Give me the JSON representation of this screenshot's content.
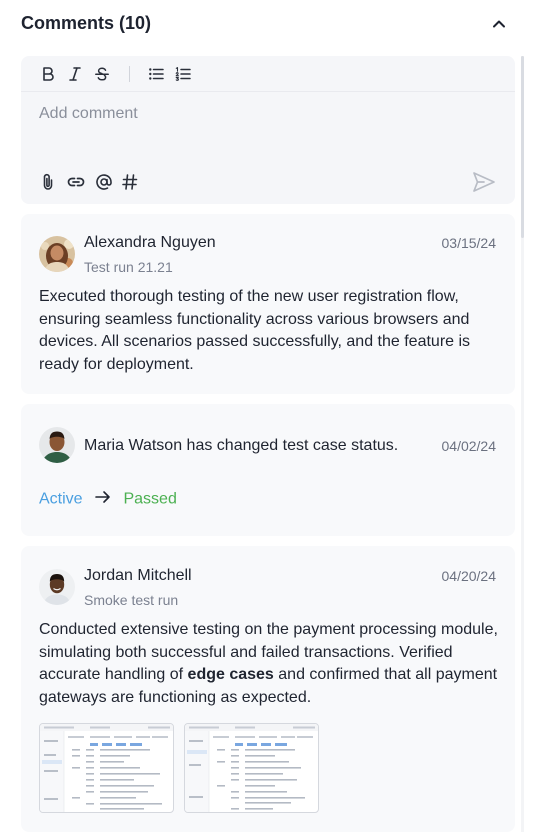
{
  "header": {
    "title": "Comments (10)",
    "collapse_icon": "chevron-up-icon"
  },
  "editor": {
    "toolbar": [
      "bold-icon",
      "italic-icon",
      "strikethrough-icon",
      "bulleted-list-icon",
      "numbered-list-icon"
    ],
    "placeholder": "Add comment",
    "actions": [
      "attachment-icon",
      "link-icon",
      "mention-icon",
      "hashtag-icon"
    ],
    "send_icon": "send-icon"
  },
  "comments": [
    {
      "author": "Alexandra Nguyen",
      "subtitle": "Test run 21.21",
      "date": "03/15/24",
      "text": "Executed thorough testing of the new user registration flow, ensuring seamless functionality across various browsers and devices. All scenarios passed successfully, and the feature is ready for deployment."
    },
    {
      "message": "Maria Watson has changed test case status.",
      "date": "04/02/24",
      "status_from": "Active",
      "status_to": "Passed"
    },
    {
      "author": "Jordan Mitchell",
      "subtitle": "Smoke test run",
      "date": "04/20/24",
      "text_before": "Conducted extensive testing on the payment processing module, simulating both successful and failed transactions. Verified accurate handling of ",
      "text_bold": "edge cases",
      "text_after": " and confirmed that all payment gateways are functioning as expected.",
      "attachments": [
        "screenshot-thumbnail",
        "screenshot-thumbnail"
      ]
    }
  ],
  "colors": {
    "status_from": "#4a9fe0",
    "status_to": "#4bb051",
    "card_bg": "#f8f9fb",
    "editor_bg": "#f5f6f9"
  }
}
